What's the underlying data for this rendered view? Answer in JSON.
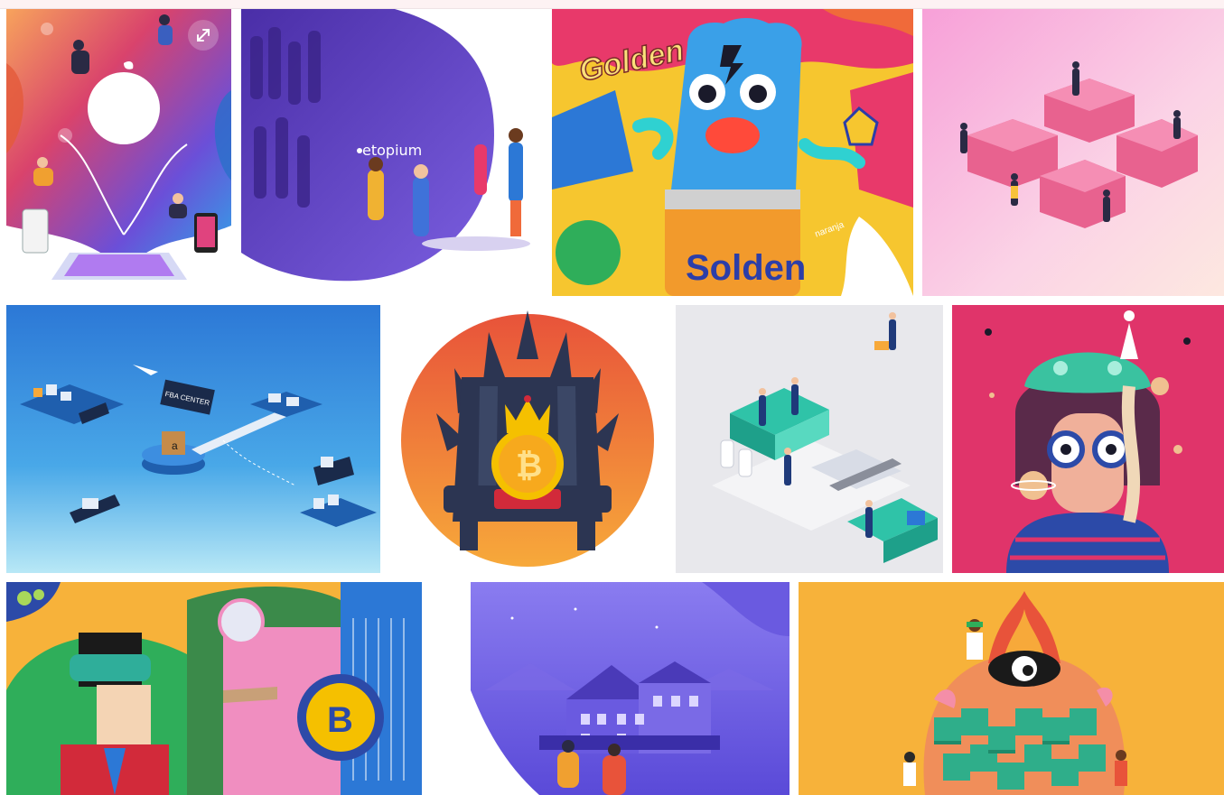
{
  "gallery": {
    "tiles": [
      {
        "name": "tile-apple-illustration"
      },
      {
        "name": "tile-etopium-illustration",
        "brand_text": "etopium"
      },
      {
        "name": "tile-golden-gummy-illustration",
        "brand_text": "Golden",
        "can_text": "Solden",
        "can_text_2": "naranja"
      },
      {
        "name": "tile-puzzle-teamwork-illustration"
      },
      {
        "name": "tile-fba-center-illustration",
        "sign_text": "FBA CENTER"
      },
      {
        "name": "tile-bitcoin-throne-illustration",
        "coin_symbol": "₿"
      },
      {
        "name": "tile-isometric-factory-illustration"
      },
      {
        "name": "tile-space-girl-illustration"
      },
      {
        "name": "tile-vr-bitcoin-illustration",
        "coin_symbol": "B"
      },
      {
        "name": "tile-purple-houses-illustration"
      },
      {
        "name": "tile-monster-blocks-illustration"
      }
    ]
  },
  "colors": {
    "topbar": "#fdf2f3",
    "accent_pink": "#e8396a",
    "accent_orange": "#f7a93a",
    "accent_blue": "#2c78d6",
    "accent_purple": "#5a3bb5"
  },
  "icons": {
    "expand": "expand-arrows-icon"
  }
}
